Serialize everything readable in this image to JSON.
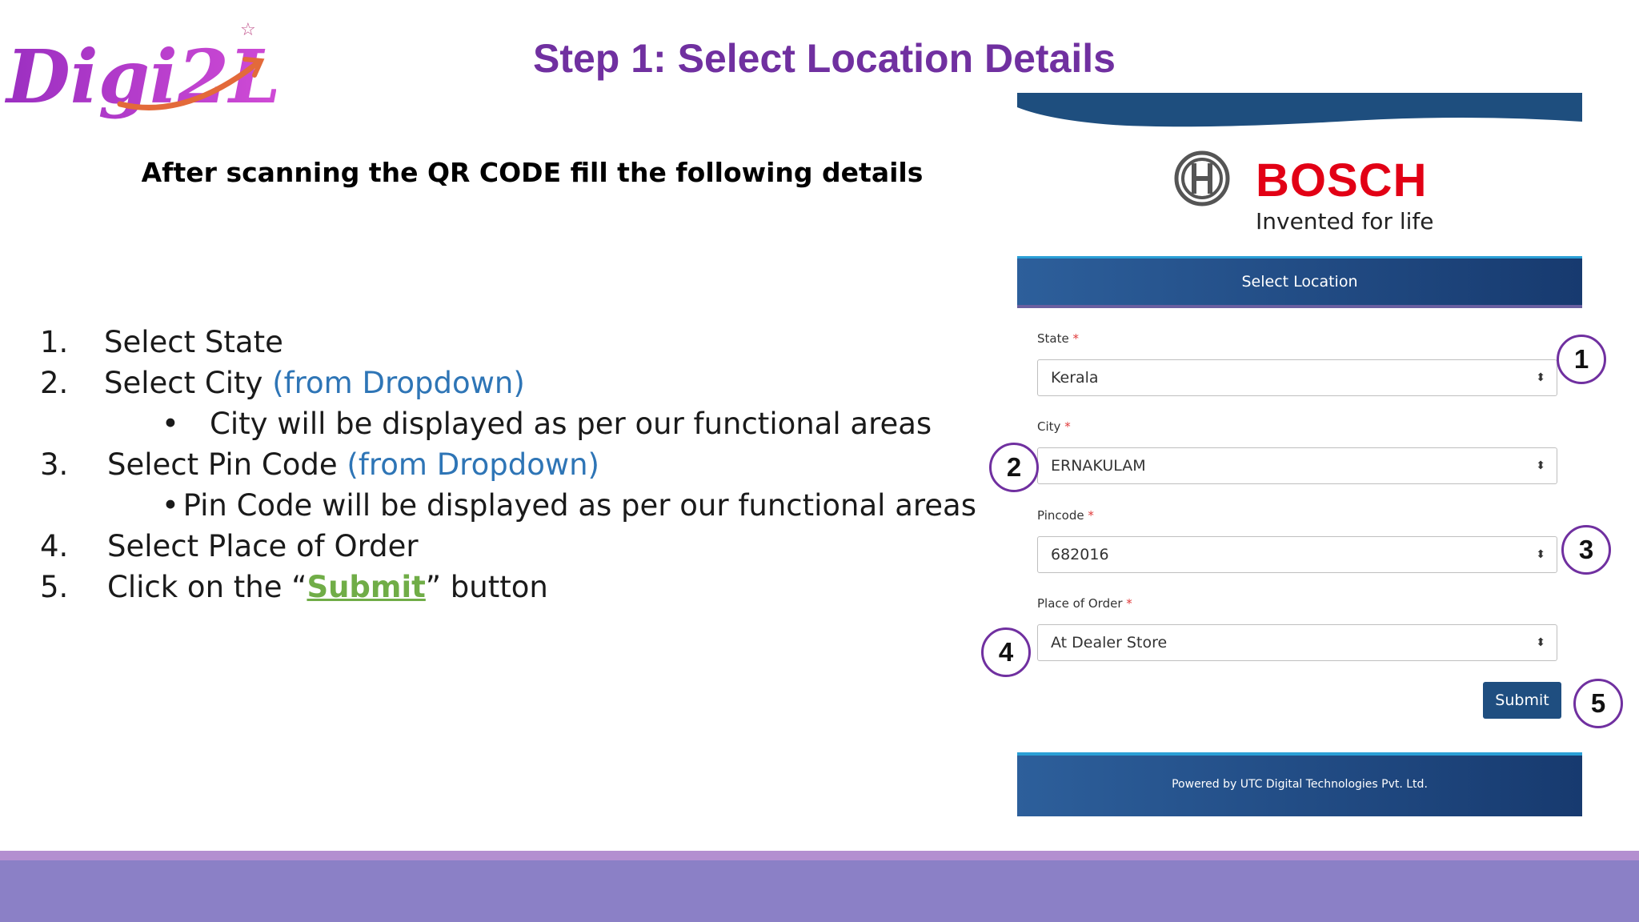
{
  "logo": {
    "text": "Digi2L",
    "star": "☆"
  },
  "title": "Step 1: Select Location Details",
  "subtitle": "After scanning the QR CODE fill the following details",
  "steps": {
    "s1": {
      "num": "1.",
      "text": "Select State"
    },
    "s2": {
      "num": "2.",
      "text": "Select City ",
      "note": "(from Dropdown)"
    },
    "s2b": {
      "bullet": "•",
      "text": "City will be displayed as per our functional areas"
    },
    "s3": {
      "num": "3.",
      "text": "Select Pin Code ",
      "note": "(from Dropdown)"
    },
    "s3b": {
      "bullet": "•",
      "text": "Pin Code will be displayed as per our functional areas"
    },
    "s4": {
      "num": "4.",
      "text": "Select Place of Order"
    },
    "s5": {
      "num": "5.",
      "pre": "Click on the “",
      "link": "Submit",
      "post": "” button"
    }
  },
  "form": {
    "brand_name": "BOSCH",
    "brand_tagline": "Invented for life",
    "header": "Select Location",
    "state": {
      "label": "State",
      "required": "*",
      "value": "Kerala"
    },
    "city": {
      "label": "City",
      "required": "*",
      "value": "ERNAKULAM"
    },
    "pincode": {
      "label": "Pincode",
      "required": "*",
      "value": "682016"
    },
    "place": {
      "label": "Place of Order",
      "required": "*",
      "value": "At Dealer Store"
    },
    "submit": "Submit",
    "footer": "Powered by UTC Digital Technologies Pvt. Ltd.",
    "caret": "⬍"
  },
  "markers": {
    "m1": "1",
    "m2": "2",
    "m3": "3",
    "m4": "4",
    "m5": "5"
  },
  "colors": {
    "title": "#7030A0",
    "note_blue": "#2E75B6",
    "submit_green": "#70AD47",
    "bosch_red": "#E20015",
    "panel_blue": "#1f4e80"
  }
}
